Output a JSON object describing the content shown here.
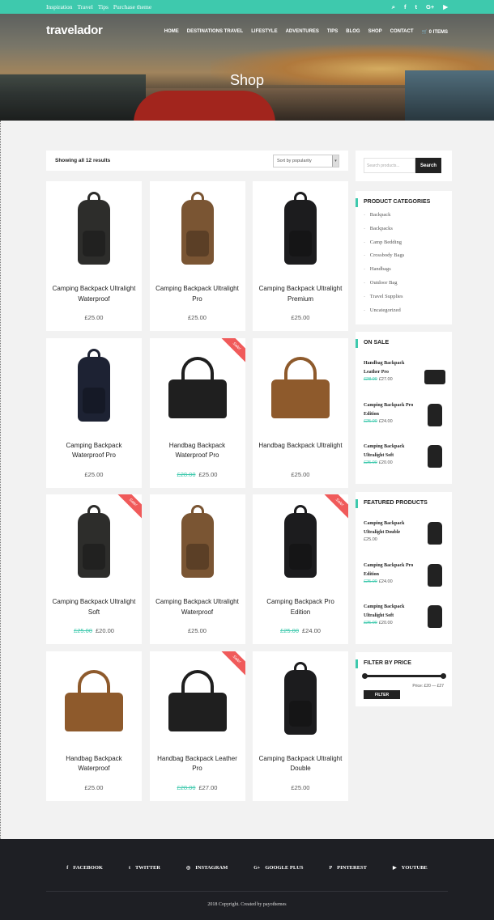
{
  "topbar": {
    "links": [
      "Inspiration",
      "Travel",
      "Tips",
      "Purchase theme"
    ],
    "social_icons": [
      "search-icon",
      "facebook-icon",
      "twitter-icon",
      "google-plus-icon",
      "youtube-icon"
    ],
    "social_glyphs": [
      "⌕",
      "f",
      "t",
      "G+",
      "▶"
    ]
  },
  "header": {
    "logo": "travelador",
    "nav": [
      "HOME",
      "DESTINATIONS TRAVEL",
      "LIFESTYLE",
      "ADVENTURES",
      "TIPS",
      "BLOG",
      "SHOP",
      "CONTACT",
      "🛒 0 ITEMS"
    ],
    "page_title": "Shop"
  },
  "toolbar": {
    "result_count": "Showing all 12 results",
    "sort_label": "Sort by popularity",
    "sort_arrow": "▾"
  },
  "products": [
    {
      "name": "Camping Backpack Ultralight Waterproof",
      "price": "£25.00",
      "old_price": "",
      "sale": false,
      "kind": "backpack",
      "color": "#2d2d2b"
    },
    {
      "name": "Camping Backpack Ultralight Pro",
      "price": "£25.00",
      "old_price": "",
      "sale": false,
      "kind": "backpack",
      "color": "#7a5533"
    },
    {
      "name": "Camping Backpack Ultralight Premium",
      "price": "£25.00",
      "old_price": "",
      "sale": false,
      "kind": "backpack",
      "color": "#1c1c1e"
    },
    {
      "name": "Camping Backpack Waterproof Pro",
      "price": "£25.00",
      "old_price": "",
      "sale": false,
      "kind": "backpack",
      "color": "#1d2233"
    },
    {
      "name": "Handbag Backpack Waterproof Pro",
      "price": "£25.00",
      "old_price": "£28.00",
      "sale": true,
      "kind": "handbag",
      "color": "#1f1f1f"
    },
    {
      "name": "Handbag Backpack Ultralight",
      "price": "£25.00",
      "old_price": "",
      "sale": false,
      "kind": "handbag",
      "color": "#8e5a2c"
    },
    {
      "name": "Camping Backpack Ultralight Soft",
      "price": "£20.00",
      "old_price": "£25.00",
      "sale": true,
      "kind": "backpack",
      "color": "#2d2d2b"
    },
    {
      "name": "Camping Backpack Ultralight Waterproof",
      "price": "£25.00",
      "old_price": "",
      "sale": false,
      "kind": "backpack",
      "color": "#7a5533"
    },
    {
      "name": "Camping Backpack Pro Edition",
      "price": "£24.00",
      "old_price": "£25.00",
      "sale": true,
      "kind": "backpack",
      "color": "#1c1c1e"
    },
    {
      "name": "Handbag Backpack Waterproof",
      "price": "£25.00",
      "old_price": "",
      "sale": false,
      "kind": "handbag",
      "color": "#8e5a2c"
    },
    {
      "name": "Handbag Backpack Leather Pro",
      "price": "£27.00",
      "old_price": "£28.00",
      "sale": true,
      "kind": "handbag",
      "color": "#1f1f1f"
    },
    {
      "name": "Camping Backpack Ultralight Double",
      "price": "£25.00",
      "old_price": "",
      "sale": false,
      "kind": "backpack",
      "color": "#1c1c1e"
    }
  ],
  "sale_label": "Sale!",
  "sidebar": {
    "search_placeholder": "Search products...",
    "search_button": "Search",
    "categories_title": "PRODUCT CATEGORIES",
    "categories": [
      "Backpack",
      "Backpacks",
      "Camp Bedding",
      "Crossbody Bags",
      "Handbags",
      "Outdoor Bag",
      "Travel Supplies",
      "Uncategorized"
    ],
    "onsale_title": "ON SALE",
    "onsale": [
      {
        "name": "Handbag Backpack Leather Pro",
        "old_price": "£28.00",
        "price": "£27.00",
        "kind": "handbag"
      },
      {
        "name": "Camping Backpack Pro Edition",
        "old_price": "£25.00",
        "price": "£24.00",
        "kind": "backpack"
      },
      {
        "name": "Camping Backpack Ultralight Soft",
        "old_price": "£25.00",
        "price": "£20.00",
        "kind": "backpack"
      }
    ],
    "featured_title": "FEATURED PRODUCTS",
    "featured": [
      {
        "name": "Camping Backpack Ultralight Double",
        "old_price": "",
        "price": "£25.00",
        "kind": "backpack"
      },
      {
        "name": "Camping Backpack Pro Edition",
        "old_price": "£25.00",
        "price": "£24.00",
        "kind": "backpack"
      },
      {
        "name": "Camping Backpack Ultralight Soft",
        "old_price": "£25.00",
        "price": "£20.00",
        "kind": "backpack"
      }
    ],
    "filter_title": "FILTER BY PRICE",
    "filter_button": "FILTER",
    "price_range": "Price: £20 — £27"
  },
  "footer": {
    "socials": [
      {
        "icon": "facebook-icon",
        "glyph": "f",
        "label": "FACEBOOK"
      },
      {
        "icon": "twitter-icon",
        "glyph": "t",
        "label": "TWITTER"
      },
      {
        "icon": "instagram-icon",
        "glyph": "◎",
        "label": "INSTAGRAM"
      },
      {
        "icon": "google-plus-icon",
        "glyph": "G+",
        "label": "GOOGLE PLUS"
      },
      {
        "icon": "pinterest-icon",
        "glyph": "P",
        "label": "PINTEREST"
      },
      {
        "icon": "youtube-icon",
        "glyph": "▶",
        "label": "YOUTUBE"
      }
    ],
    "copyright": "2018 Copyright. Created by payothemes"
  },
  "colors": {
    "accent": "#3ec9ad",
    "sale": "#f05a5a",
    "dark": "#1e1f24"
  }
}
